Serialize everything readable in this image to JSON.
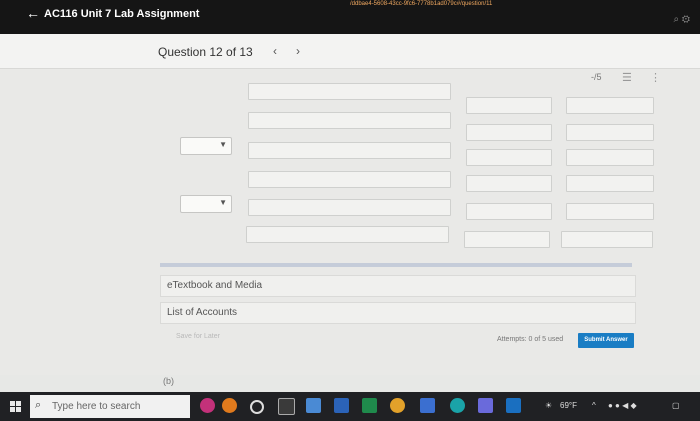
{
  "window": {
    "title": "AC116 Unit 7 Lab Assignment",
    "url_fragment": "/ddbae4-5608-43cc-9fc6-7778b1ad079c#/question/11"
  },
  "header": {
    "question_label": "Question 12 of 13",
    "prev": "‹",
    "next": "›"
  },
  "toolbar": {
    "score": "-/5",
    "list_icon": "list-icon",
    "more_icon": "more-vertical-icon"
  },
  "table": {
    "rows": 6,
    "dropdowns": [
      {
        "row": 2,
        "value": ""
      },
      {
        "row": 5,
        "value": ""
      }
    ]
  },
  "resources": {
    "etextbook": "eTextbook and Media",
    "list_of_accounts": "List of Accounts"
  },
  "actions": {
    "save_later": "Save for Later",
    "attempts": "Attempts: 0 of 5 used",
    "submit": "Submit Answer"
  },
  "next_part": {
    "label": "(b)"
  },
  "taskbar": {
    "search_placeholder": "Type here to search",
    "weather": "69°F"
  },
  "colors": {
    "submit_button": "#1a7dc4",
    "taskbar": "#202124",
    "titlebar": "#151515"
  }
}
